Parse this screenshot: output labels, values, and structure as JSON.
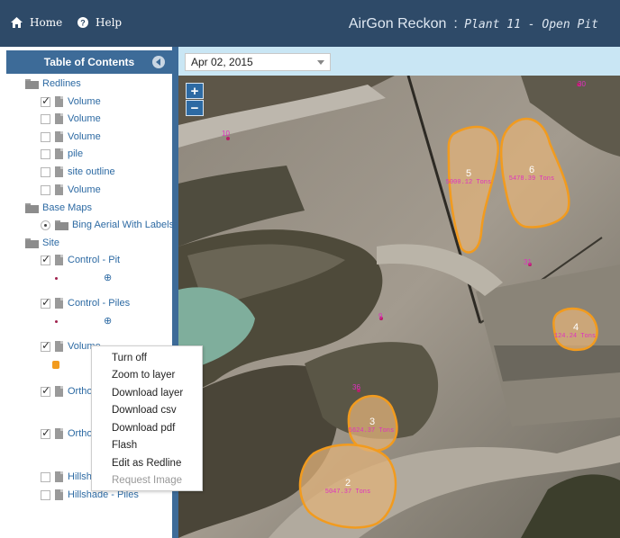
{
  "header": {
    "home_label": "Home",
    "help_label": "Help",
    "app_name": "AirGon Reckon",
    "separator": ":",
    "project_name": "Plant 11 - Open Pit"
  },
  "toc": {
    "title": "Table of Contents",
    "groups": [
      {
        "label": "Redlines",
        "items": [
          {
            "label": "Volume",
            "checked": true
          },
          {
            "label": "Volume",
            "checked": false
          },
          {
            "label": "Volume",
            "checked": false
          },
          {
            "label": "pile",
            "checked": false
          },
          {
            "label": "site outline",
            "checked": false
          },
          {
            "label": "Volume",
            "checked": false
          }
        ]
      },
      {
        "label": "Base Maps",
        "items": [
          {
            "label": "Bing Aerial With Labels",
            "selected": true
          }
        ]
      },
      {
        "label": "Site",
        "items": [
          {
            "label": "Control - Pit",
            "checked": true
          },
          {
            "label": "Control - Piles",
            "checked": true
          },
          {
            "label": "Volume",
            "checked": true
          },
          {
            "label": "Ortho",
            "checked": true
          },
          {
            "label": "Ortho",
            "checked": true
          },
          {
            "label": "Hillsh",
            "checked": false
          },
          {
            "label": "Hillshade - Piles",
            "checked": false
          }
        ]
      }
    ]
  },
  "date_selector": {
    "value": "Apr 02, 2015"
  },
  "map": {
    "zoom_in": "+",
    "zoom_out": "−",
    "piles": [
      {
        "id": "5",
        "tonnage": "5000.12 Tons"
      },
      {
        "id": "6",
        "tonnage": "5478.39 Tons"
      },
      {
        "id": "4",
        "tonnage": "124.24 Tons"
      },
      {
        "id": "3",
        "tonnage": "5624.37 Tons"
      },
      {
        "id": "2",
        "tonnage": "5047.37 Tons"
      }
    ],
    "control_points": [
      "30",
      "10",
      "31",
      "9",
      "36"
    ],
    "pile_color": "#f29b1e",
    "label_color": "#e030c0"
  },
  "context_menu": {
    "items": [
      {
        "label": "Turn off",
        "enabled": true
      },
      {
        "label": "Zoom to layer",
        "enabled": true
      },
      {
        "label": "Download layer",
        "enabled": true
      },
      {
        "label": "Download csv",
        "enabled": true
      },
      {
        "label": "Download pdf",
        "enabled": true
      },
      {
        "label": "Flash",
        "enabled": true
      },
      {
        "label": "Edit as Redline",
        "enabled": true
      },
      {
        "label": "Request Image",
        "enabled": false
      }
    ]
  }
}
